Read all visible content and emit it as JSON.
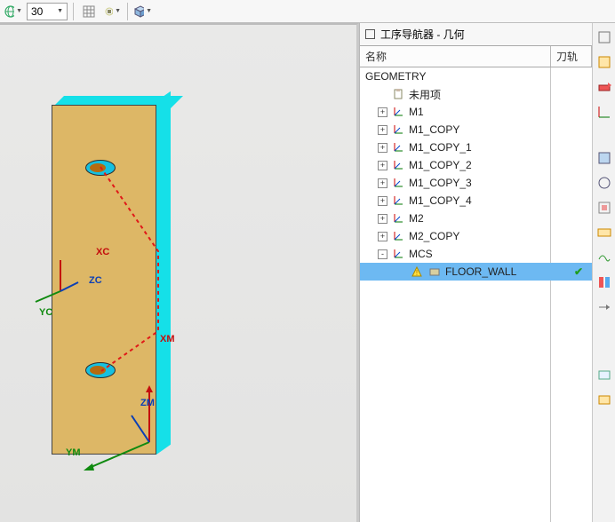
{
  "toolbar": {
    "globe_icon": "globe-icon",
    "size_value": "30",
    "grid_icon": "grid-icon",
    "snap_icon": "snap-icon",
    "cube_icon": "cube-icon"
  },
  "panel": {
    "title": "工序导航器 - 几何",
    "columns": {
      "name": "名称",
      "track": "刀轨"
    }
  },
  "tree": {
    "root": "GEOMETRY",
    "unused": "未用项",
    "items": [
      {
        "label": "M1"
      },
      {
        "label": "M1_COPY"
      },
      {
        "label": "M1_COPY_1"
      },
      {
        "label": "M1_COPY_2"
      },
      {
        "label": "M1_COPY_3"
      },
      {
        "label": "M1_COPY_4"
      },
      {
        "label": "M2"
      },
      {
        "label": "M2_COPY"
      }
    ],
    "mcs": {
      "label": "MCS",
      "child": "FLOOR_WALL",
      "child_status": "✔"
    }
  },
  "viewport": {
    "axes": {
      "xc": "XC",
      "yc": "YC",
      "zc": "ZC",
      "xm": "XM",
      "ym": "YM",
      "zm": "ZM"
    }
  },
  "colors": {
    "part_face": "#ddb766",
    "part_side": "#15e0e8",
    "toolpath": "#e01818"
  }
}
